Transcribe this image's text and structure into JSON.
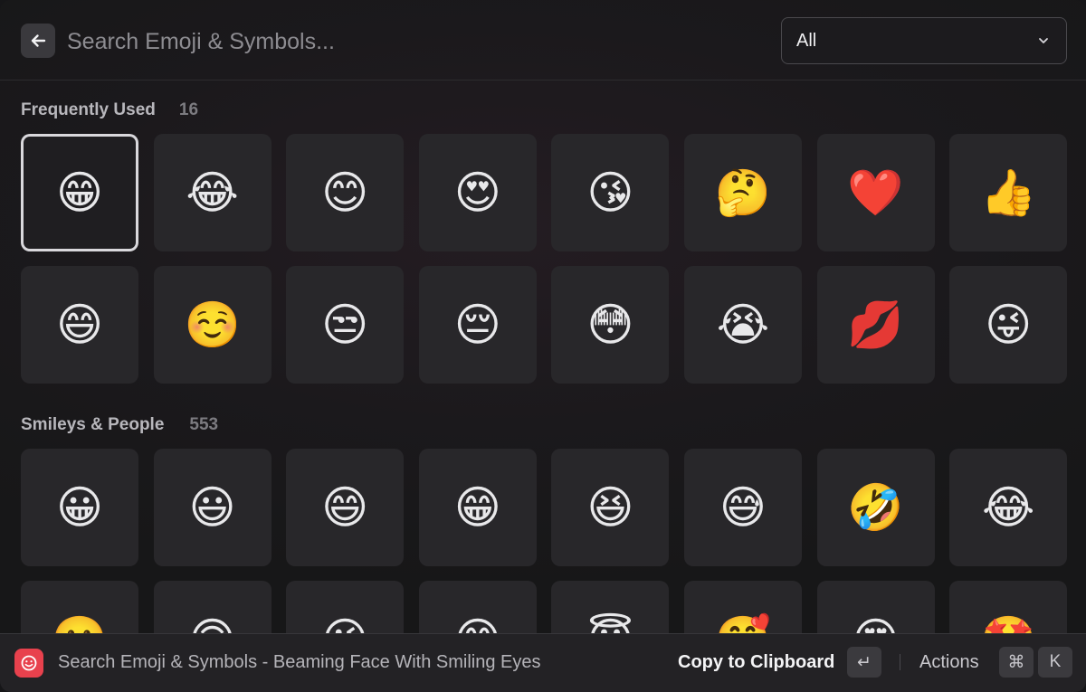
{
  "search": {
    "placeholder": "Search Emoji & Symbols...",
    "value": ""
  },
  "filter": {
    "selected": "All"
  },
  "sections": [
    {
      "title": "Frequently Used",
      "count": "16",
      "emojis": [
        "😁",
        "😂",
        "😊",
        "😍",
        "😘",
        "🤔",
        "❤️",
        "👍",
        "😄",
        "☺️",
        "😒",
        "😔",
        "😳",
        "😭",
        "💋",
        "😜"
      ],
      "selected_index": 0
    },
    {
      "title": "Smileys & People",
      "count": "553",
      "emojis": [
        "😀",
        "😃",
        "😄",
        "😁",
        "😆",
        "😅",
        "🤣",
        "😂",
        "🙂",
        "🙃",
        "😉",
        "😊",
        "😇",
        "🥰",
        "😍",
        "🤩"
      ]
    }
  ],
  "footer": {
    "title": "Search Emoji & Symbols - Beaming Face With Smiling Eyes",
    "primary_action": "Copy to Clipboard",
    "enter_key": "↵",
    "actions_label": "Actions",
    "cmd_key": "⌘",
    "k_key": "K"
  },
  "colors": {
    "accent_icon": "#e8414d",
    "selection_border": "#d9d8dc",
    "cell_bg": "#28272a"
  },
  "icons": {
    "back": "arrow-left-icon",
    "dropdown": "chevron-down-icon",
    "app": "emoji-smile-icon"
  }
}
